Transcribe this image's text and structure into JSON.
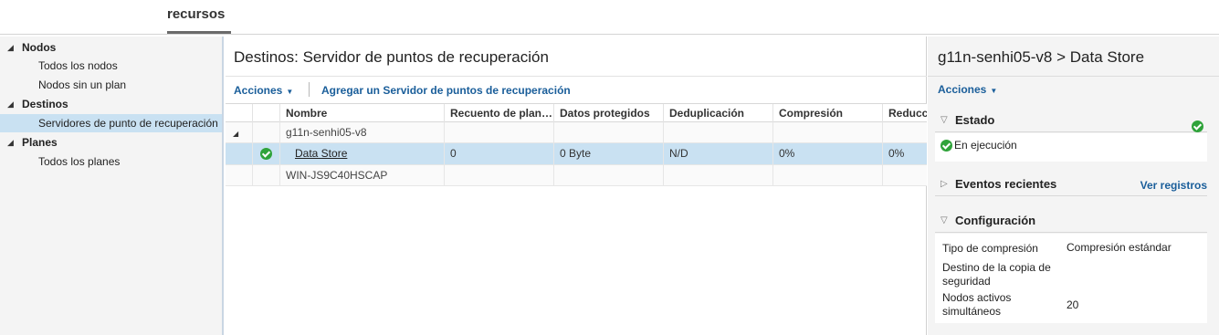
{
  "top_tab": {
    "label": "recursos"
  },
  "nav": {
    "groups": [
      {
        "label": "Nodos",
        "items": [
          "Todos los nodos",
          "Nodos sin un plan"
        ]
      },
      {
        "label": "Destinos",
        "items": [
          "Servidores de punto de recuperación"
        ]
      },
      {
        "label": "Planes",
        "items": [
          "Todos los planes"
        ]
      }
    ],
    "selected": "Servidores de punto de recuperación"
  },
  "center": {
    "title": "Destinos: Servidor de puntos de recuperación",
    "toolbar": {
      "actions_label": "Acciones",
      "add_label": "Agregar un Servidor de puntos de recuperación"
    },
    "columns": [
      "Nombre",
      "Recuento de plan…",
      "Datos protegidos",
      "Deduplicación",
      "Compresión",
      "Reducc"
    ],
    "rows": [
      {
        "type": "group",
        "name": "g11n-senhi05-v8",
        "expanded": true
      },
      {
        "type": "item",
        "status_icon": "check-circle-icon",
        "name": "Data Store",
        "plan_count": "0",
        "protected_data": "0 Byte",
        "dedup": "N/D",
        "compression": "0%",
        "reduction": "0%",
        "selected": true
      },
      {
        "type": "group",
        "name": "WIN-JS9C40HSCAP",
        "expanded": false
      }
    ]
  },
  "right": {
    "title": "g11n-senhi05-v8 > Data Store",
    "actions_label": "Acciones",
    "estado": {
      "title": "Estado",
      "status_text": "En ejecución"
    },
    "eventos": {
      "title": "Eventos recientes",
      "link": "Ver registros"
    },
    "config": {
      "title": "Configuración",
      "items": [
        {
          "key": "Tipo de compresión",
          "value": "Compresión estándar"
        },
        {
          "key": "Destino de la copia de seguridad",
          "value": ""
        },
        {
          "key": "Nodos activos simultáneos",
          "value": "20"
        }
      ]
    }
  },
  "colors": {
    "accent_link": "#1a5e9a",
    "selection": "#c9e1f2",
    "success": "#2fa33a"
  }
}
